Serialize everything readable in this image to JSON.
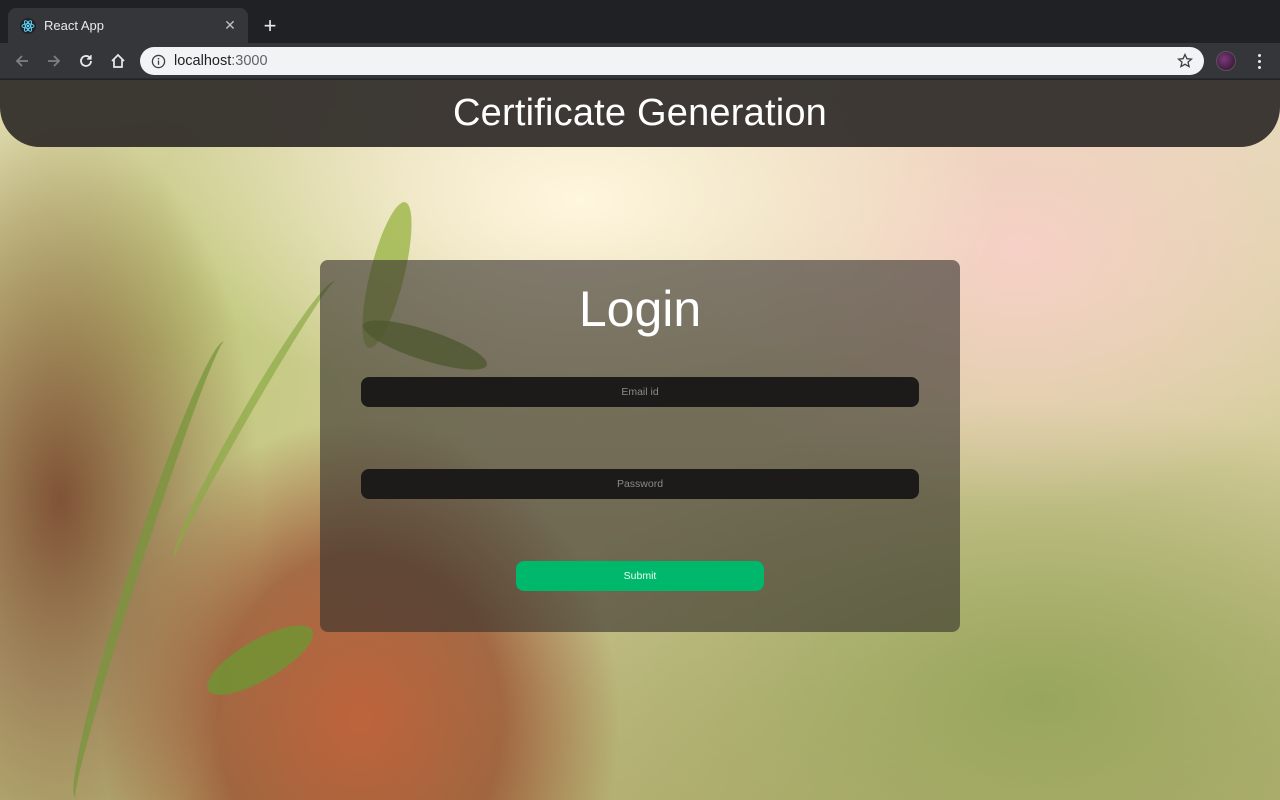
{
  "browser": {
    "tab_title": "React App",
    "tab_close_icon": "close-icon",
    "new_tab_icon": "plus-icon",
    "url_host": "localhost",
    "url_port": ":3000",
    "icons": [
      "back-arrow-icon",
      "forward-arrow-icon",
      "reload-icon",
      "home-icon",
      "info-icon",
      "star-icon",
      "profile-avatar",
      "kebab-menu-icon"
    ]
  },
  "header": {
    "title": "Certificate Generation"
  },
  "login": {
    "title": "Login",
    "email_placeholder": "Email id",
    "email_value": "",
    "password_placeholder": "Password",
    "password_value": "",
    "submit_label": "Submit"
  },
  "colors": {
    "header_bg": "#322e2a",
    "submit_bg": "#00b86b",
    "input_bg": "#1c1b19"
  }
}
